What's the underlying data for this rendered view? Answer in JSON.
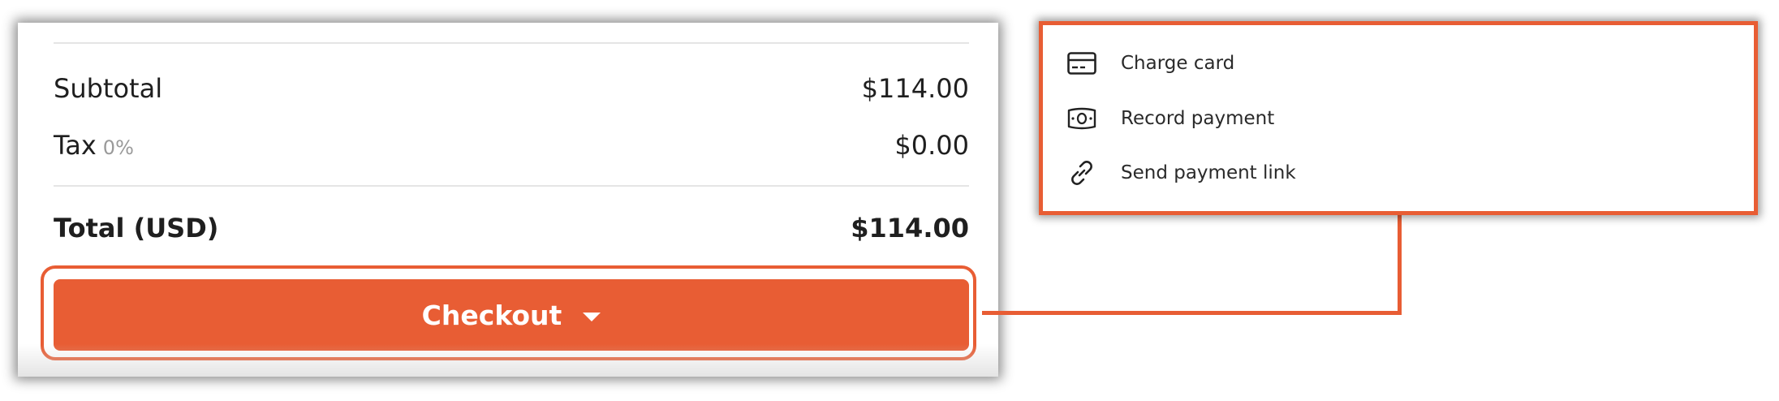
{
  "summary": {
    "subtotal_label": "Subtotal",
    "subtotal_value": "$114.00",
    "tax_label": "Tax",
    "tax_rate": "0%",
    "tax_value": "$0.00",
    "total_label": "Total (USD)",
    "total_value": "$114.00"
  },
  "checkout": {
    "label": "Checkout",
    "icon": "chevron-down-icon"
  },
  "menu": {
    "items": [
      {
        "label": "Charge card",
        "icon": "credit-card-icon"
      },
      {
        "label": "Record payment",
        "icon": "cash-icon"
      },
      {
        "label": "Send payment link",
        "icon": "link-icon"
      }
    ]
  },
  "colors": {
    "accent": "#e85d34",
    "text": "#1f1f1f",
    "muted": "#9a9a9a"
  }
}
